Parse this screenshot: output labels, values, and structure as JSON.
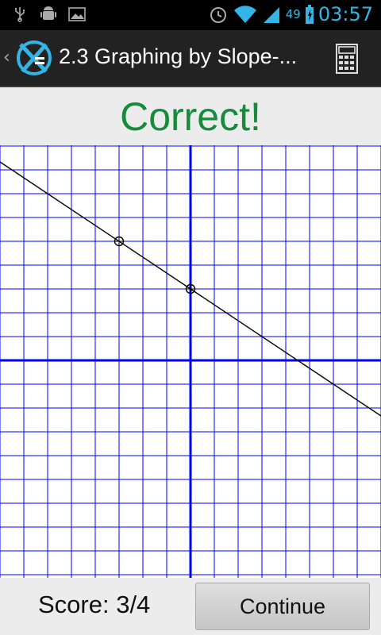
{
  "status_bar": {
    "battery_percent": "49",
    "clock": "03:57",
    "icons": [
      "usb-icon",
      "android-debug-icon",
      "gallery-icon",
      "alarm-icon",
      "wifi-icon",
      "signal-icon",
      "battery-icon"
    ]
  },
  "action_bar": {
    "title": "2.3 Graphing by Slope-...",
    "app_icon": "x-equals-logo-icon",
    "calculator_icon": "calculator-icon"
  },
  "result": {
    "text": "Correct!",
    "color": "#178a3d"
  },
  "graph": {
    "grid_color": "#0000ff",
    "axis_color": "#0000ff",
    "line_color": "#000000",
    "x_range": [
      -8,
      8
    ],
    "y_range": [
      -9,
      9
    ],
    "points": [
      {
        "x": -3,
        "y": 5
      },
      {
        "x": 0,
        "y": 3
      }
    ],
    "line": {
      "slope": -0.6666667,
      "intercept": 3
    }
  },
  "bottom_bar": {
    "score": "Score: 3/4",
    "continue_label": "Continue"
  }
}
